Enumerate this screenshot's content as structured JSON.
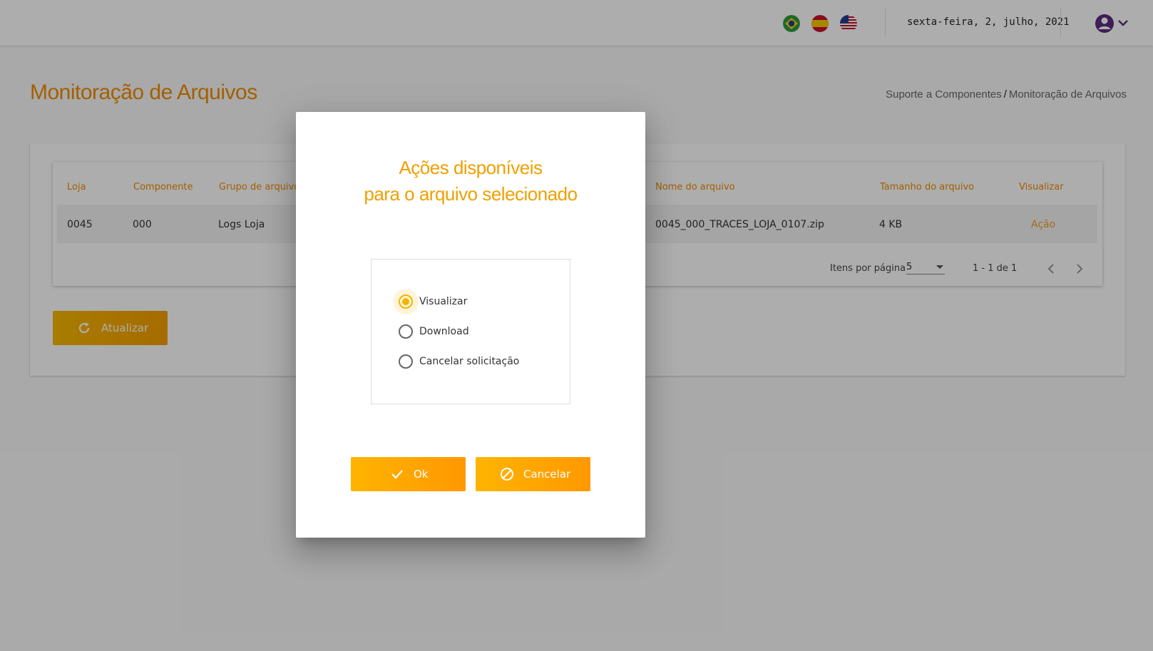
{
  "header": {
    "flags": [
      "brazil-flag",
      "spain-flag",
      "usa-flag"
    ],
    "date": "sexta-feira, 2, julho, 2021",
    "user_icon": "account-circle-icon"
  },
  "page": {
    "title": "Monitoração de Arquivos",
    "breadcrumb": {
      "parent": "Suporte a Componentes",
      "separator": "/",
      "current": "Monitoração de Arquivos"
    }
  },
  "table": {
    "columns": [
      "Loja",
      "Componente",
      "Grupo de arquivos",
      "Nome do arquivo",
      "Tamanho do arquivo",
      "Visualizar"
    ],
    "rows": [
      {
        "loja": "0045",
        "componente": "000",
        "grupo": "Logs Loja",
        "nome": "0045_000_TRACES_LOJA_0107.zip",
        "tamanho": "4 KB",
        "visualizar": "Ação"
      }
    ],
    "paginator": {
      "items_label": "Itens por página",
      "page_size": "5",
      "range": "1 - 1 de 1"
    }
  },
  "refresh_button": {
    "label": "Atualizar",
    "icon": "refresh-icon"
  },
  "dialog": {
    "title_line1": "Ações disponíveis",
    "title_line2": "para o arquivo selecionado",
    "options": [
      {
        "label": "Visualizar",
        "checked": true
      },
      {
        "label": "Download",
        "checked": false
      },
      {
        "label": "Cancelar solicitação",
        "checked": false
      }
    ],
    "ok_label": "Ok",
    "cancel_label": "Cancelar"
  },
  "colors": {
    "accent": "#f08c00",
    "button": "#ffa800",
    "overlay": "rgba(0,0,0,0.32)"
  }
}
